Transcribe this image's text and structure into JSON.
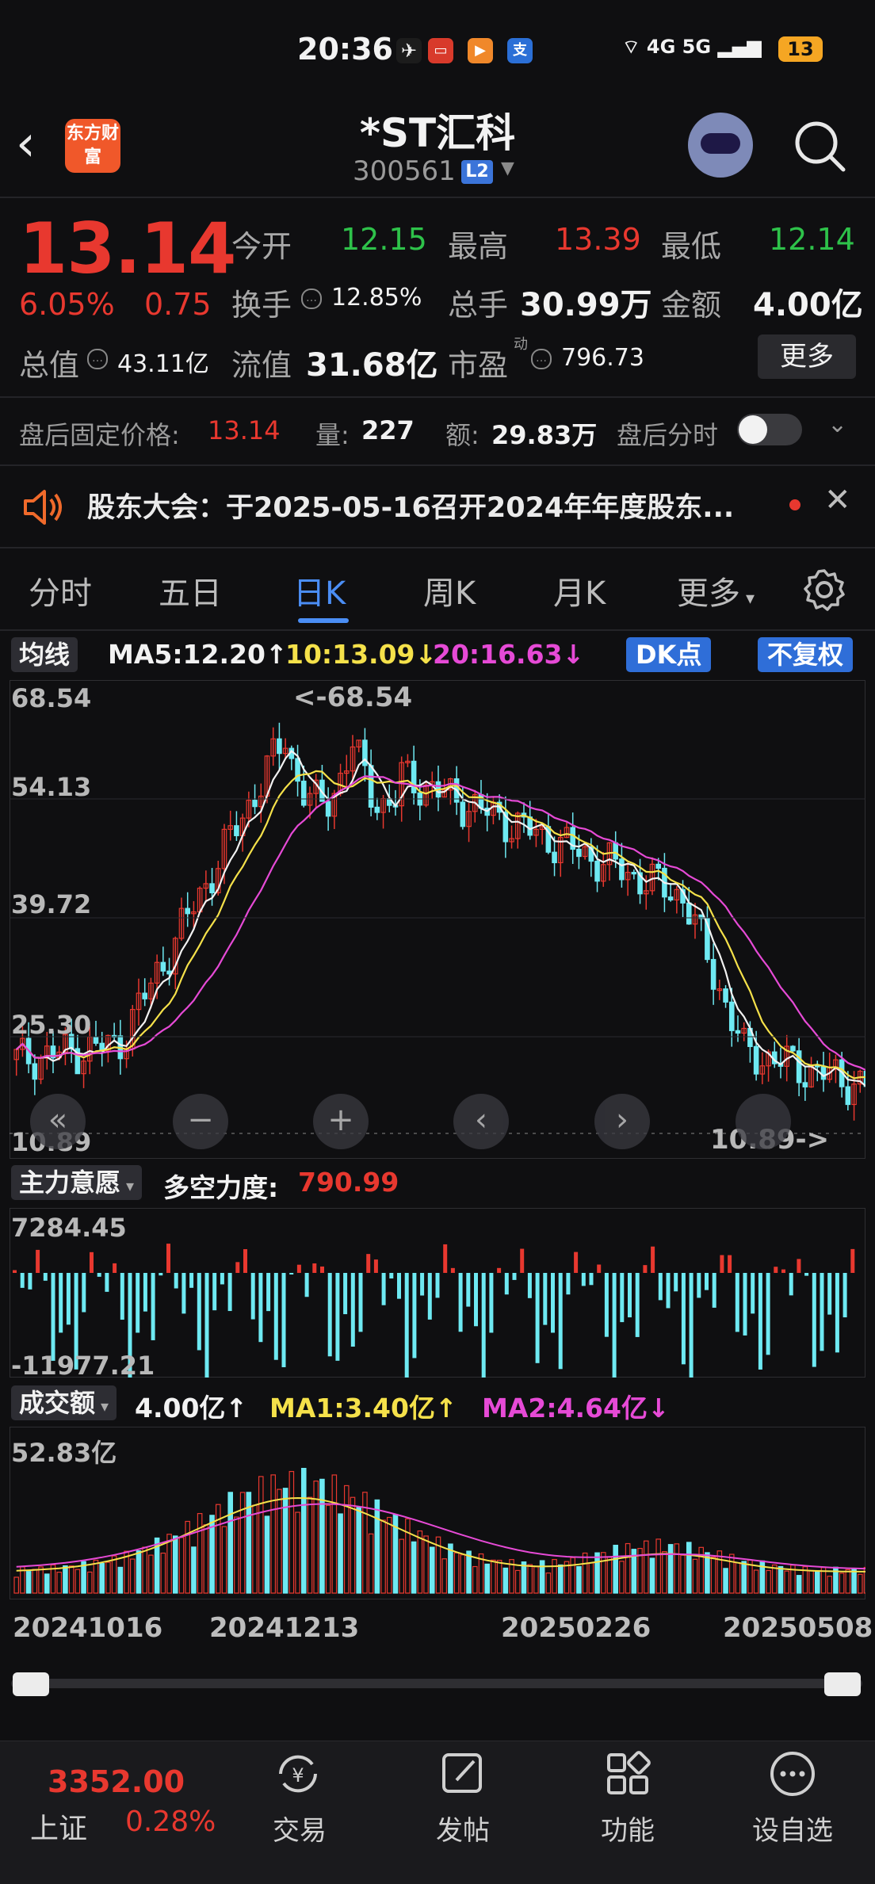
{
  "status_bar": {
    "time": "20:36",
    "network": "4G 5G",
    "battery": "13"
  },
  "header": {
    "title": "*ST汇科",
    "code": "300561",
    "level_badge": "L2",
    "logo_text": "东方财富"
  },
  "quote": {
    "price": "13.14",
    "change_pct": "6.05%",
    "change": "0.75",
    "open_label": "今开",
    "open": "12.15",
    "high_label": "最高",
    "high": "13.39",
    "low_label": "最低",
    "low": "12.14",
    "turnover_label": "换手",
    "turnover": "12.85%",
    "volume_label": "总手",
    "volume": "30.99万",
    "amount_label": "金额",
    "amount": "4.00亿",
    "mktcap_label": "总值",
    "mktcap": "43.11亿",
    "float_label": "流值",
    "float_cap": "31.68亿",
    "pe_label": "市盈",
    "pe_sup": "动",
    "pe": "796.73",
    "more_button": "更多"
  },
  "after_hours": {
    "price_label": "盘后固定价格:",
    "price": "13.14",
    "qty_label": "量:",
    "qty": "227",
    "amt_label": "额:",
    "amt": "29.83万",
    "timeshare_label": "盘后分时"
  },
  "notice": {
    "text": "股东大会：于2025-05-16召开2024年年度股东..."
  },
  "tabs": [
    "分时",
    "五日",
    "日K",
    "周K",
    "月K",
    "更多"
  ],
  "active_tab": "日K",
  "ma_legend": {
    "label": "均线",
    "ma5": "MA5:12.20↑",
    "ma10": "10:13.09↓",
    "ma20": "20:16.63↓",
    "dk_button": "DK点",
    "adj_button": "不复权"
  },
  "kline_chart": {
    "y_labels": [
      "68.54",
      "54.13",
      "39.72",
      "25.30",
      "10.89"
    ],
    "max_marker": "<-68.54",
    "min_marker": "10.89->",
    "colors": {
      "up": "#e8382f",
      "down": "#6ee9f2",
      "ma5": "#f2f2f2",
      "ma10": "#f5e14a",
      "ma20": "#e64ad6"
    }
  },
  "flow_panel": {
    "label": "主力意愿",
    "title": "多空力度:",
    "value": "790.99",
    "y_max": "7284.45",
    "y_min": "-11977.21"
  },
  "volume_panel": {
    "label": "成交额",
    "current": "4.00亿↑",
    "ma1": "MA1:3.40亿↑",
    "ma2": "MA2:4.64亿↓",
    "y_max": "52.83亿"
  },
  "dates": [
    "20241016",
    "20241213",
    "20250226",
    "20250508"
  ],
  "nav_buttons": [
    "«",
    "−",
    "+",
    "‹",
    "›"
  ],
  "bottom_bar": {
    "index_value": "3352.00",
    "index_name": "上证",
    "index_pct": "0.28%",
    "items": [
      "交易",
      "发帖",
      "功能",
      "设自选"
    ]
  }
}
